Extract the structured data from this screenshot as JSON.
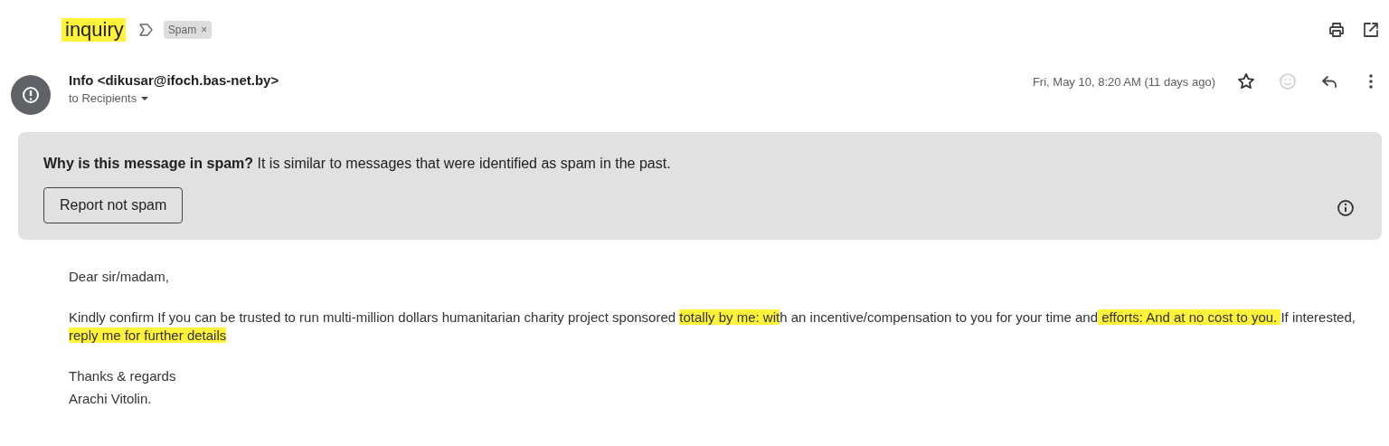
{
  "subject": {
    "text": "inquiry",
    "highlighted": true
  },
  "labels": [
    {
      "text": "Spam",
      "remove": "×"
    }
  ],
  "sender": {
    "name": "Info <dikusar@ifoch.bas-net.by>",
    "recipients": "to Recipients",
    "date": "Fri, May 10, 8:20 AM (11 days ago)",
    "starred": false
  },
  "spam_banner": {
    "question": "Why is this message in spam?",
    "reason": "It is similar to messages that were identified as spam in the past.",
    "button": "Report not spam"
  },
  "body": [
    {
      "segments": [
        {
          "text": "Dear sir/madam,",
          "highlighted": false
        }
      ]
    },
    {
      "segments": [
        {
          "text": "Kindly confirm If you can be trusted to run multi-million dollars humanitarian charity project sponsored ",
          "highlighted": false
        },
        {
          "text": "totally by me: wit",
          "highlighted": true
        },
        {
          "text": "h an incentive/compensation to you for your time and",
          "highlighted": false
        },
        {
          "text": " efforts: And at no cost to you. ",
          "highlighted": true
        },
        {
          "text": "If interested, ",
          "highlighted": false
        },
        {
          "text": "reply me for further details     ",
          "highlighted": true
        }
      ]
    },
    {
      "segments": [
        {
          "text": "Thanks & regards",
          "highlighted": false
        }
      ]
    },
    {
      "segments": [
        {
          "text": "Arachi Vitolin.",
          "highlighted": false
        }
      ]
    }
  ]
}
